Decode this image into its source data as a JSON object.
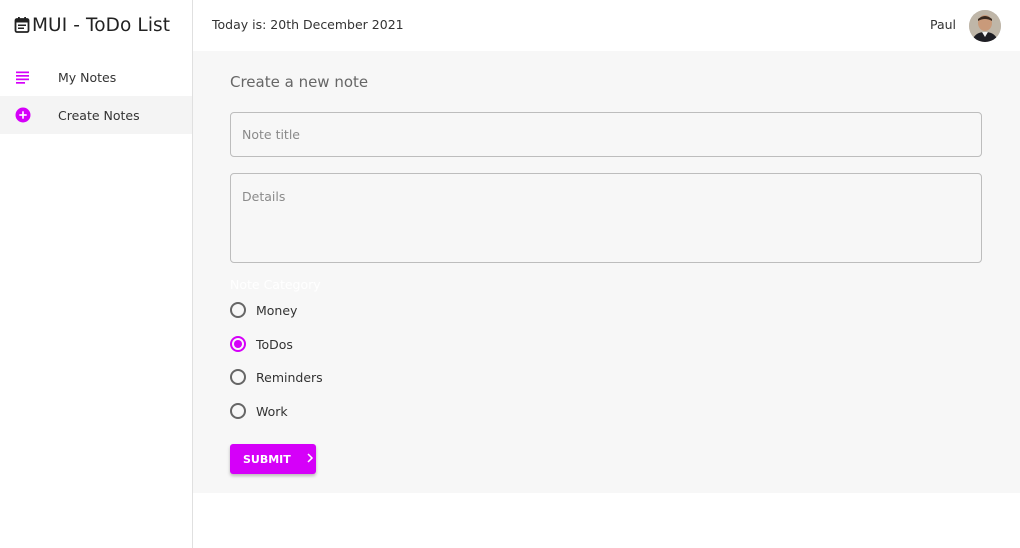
{
  "app": {
    "title": "MUI - ToDo List",
    "brand_icon": "calendar-note-icon",
    "accent_color": "#d500f9"
  },
  "sidebar": {
    "items": [
      {
        "label": "My Notes",
        "icon": "subject-lines-icon",
        "active": false
      },
      {
        "label": "Create Notes",
        "icon": "add-circle-icon",
        "active": true
      }
    ]
  },
  "header": {
    "today_text": "Today is: 20th December 2021",
    "username": "Paul",
    "avatar_icon": "user-avatar"
  },
  "form": {
    "page_title": "Create a new note",
    "title_placeholder": "Note title",
    "title_value": "",
    "details_placeholder": "Details",
    "details_value": "",
    "category_legend": "Note Category",
    "categories": [
      {
        "label": "Money",
        "checked": false
      },
      {
        "label": "ToDos",
        "checked": true
      },
      {
        "label": "Reminders",
        "checked": false
      },
      {
        "label": "Work",
        "checked": false
      }
    ],
    "submit_label": "SUBMIT",
    "submit_icon": "chevron-right-icon"
  }
}
